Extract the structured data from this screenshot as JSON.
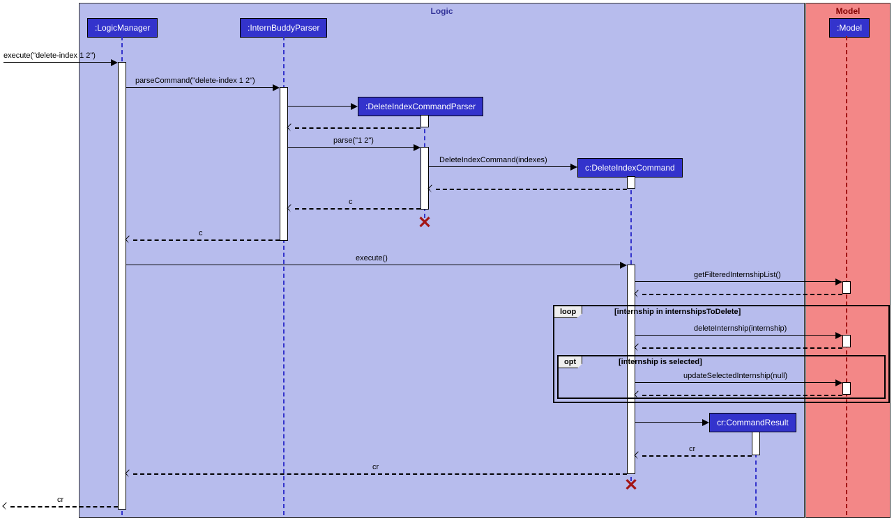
{
  "regions": {
    "logic_title": "Logic",
    "model_title": "Model"
  },
  "participants": {
    "logic_manager": ":LogicManager",
    "intern_buddy_parser": ":InternBuddyParser",
    "delete_index_parser": ":DeleteIndexCommandParser",
    "delete_index_command": "c:DeleteIndexCommand",
    "model": ":Model",
    "command_result": "cr:CommandResult"
  },
  "messages": {
    "execute_cmd": "execute(\"delete-index 1 2\")",
    "parse_command": "parseCommand(\"delete-index 1 2\")",
    "parse_args": "parse(\"1 2\")",
    "new_delete_index_cmd": "DeleteIndexCommand(indexes)",
    "return_c1": "c",
    "return_c2": "c",
    "execute_empty": "execute()",
    "get_filtered_list": "getFilteredInternshipList()",
    "delete_internship": "deleteInternship(internship)",
    "update_selected": "updateSelectedInternship(null)",
    "return_cr1": "cr",
    "return_cr2": "cr",
    "return_cr3": "cr"
  },
  "fragments": {
    "loop_label": "loop",
    "loop_guard": "[internship in internshipsToDelete]",
    "opt_label": "opt",
    "opt_guard": "[internship is selected]"
  }
}
